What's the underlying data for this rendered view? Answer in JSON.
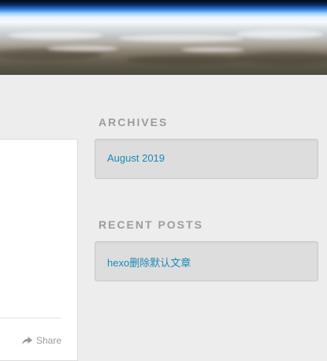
{
  "sidebar": {
    "archives": {
      "title": "ARCHIVES",
      "items": [
        {
          "label": "August 2019"
        }
      ]
    },
    "recent_posts": {
      "title": "RECENT POSTS",
      "items": [
        {
          "label": "hexo删除默认文章"
        }
      ]
    }
  },
  "post": {
    "share_label": "Share",
    "share_icon": "share-arrow-icon"
  },
  "colors": {
    "page_background": "#ededed",
    "link": "#1a8ab8",
    "widget_title": "#9c9c9c",
    "widget_background": "#dddddd"
  }
}
